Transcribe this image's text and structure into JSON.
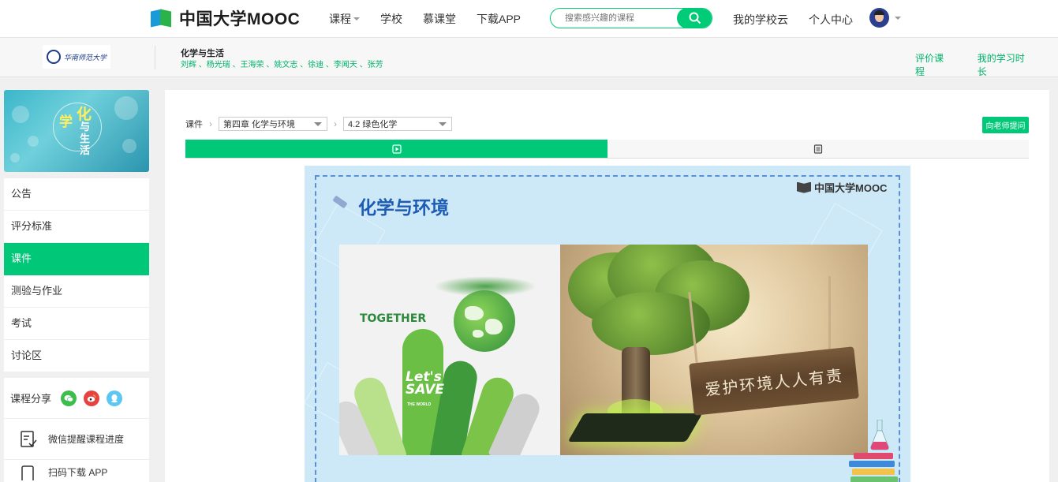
{
  "nav": {
    "logo_text": "中国大学MOOC",
    "links": [
      "课程",
      "学校",
      "慕课堂",
      "下载APP"
    ],
    "search_placeholder": "搜索感兴趣的课程",
    "right_links": [
      "我的学校云",
      "个人中心"
    ]
  },
  "course": {
    "school_name": "华南师范大学",
    "title": "化学与生活",
    "teachers": "刘辉 、杨光瑞 、王海荣 、姚文志 、徐迪 、李闻天 、张芳",
    "links": [
      "评价课程",
      "我的学习时长"
    ]
  },
  "sidebar": {
    "banner": {
      "char_hua": "化",
      "char_xue": "学",
      "char_rest": "与生活"
    },
    "menu": [
      "公告",
      "评分标准",
      "课件",
      "测验与作业",
      "考试",
      "讨论区"
    ],
    "active_index": 2,
    "share_label": "课程分享",
    "remind_label": "微信提醒课程进度",
    "download_label": "扫码下载 APP"
  },
  "main": {
    "crumb_root": "课件",
    "chapter_select": "第四章 化学与环境",
    "section_select": "4.2 绿色化学",
    "ask_button": "向老师提问",
    "tabs": [
      {
        "icon": "play-icon",
        "active": true
      },
      {
        "icon": "document-icon",
        "active": false
      }
    ]
  },
  "slide": {
    "title": "化学与环境",
    "mooc_mark": "中国大学MOOC",
    "together": "TOGETHER",
    "lets": "Let's",
    "save": "SAVE",
    "the_world": "THE WORLD",
    "sign_text": "爱护环境人人有责"
  },
  "colors": {
    "brand_green": "#00c878",
    "slide_bg": "#cde9f7",
    "slide_title": "#1e5bb5"
  }
}
